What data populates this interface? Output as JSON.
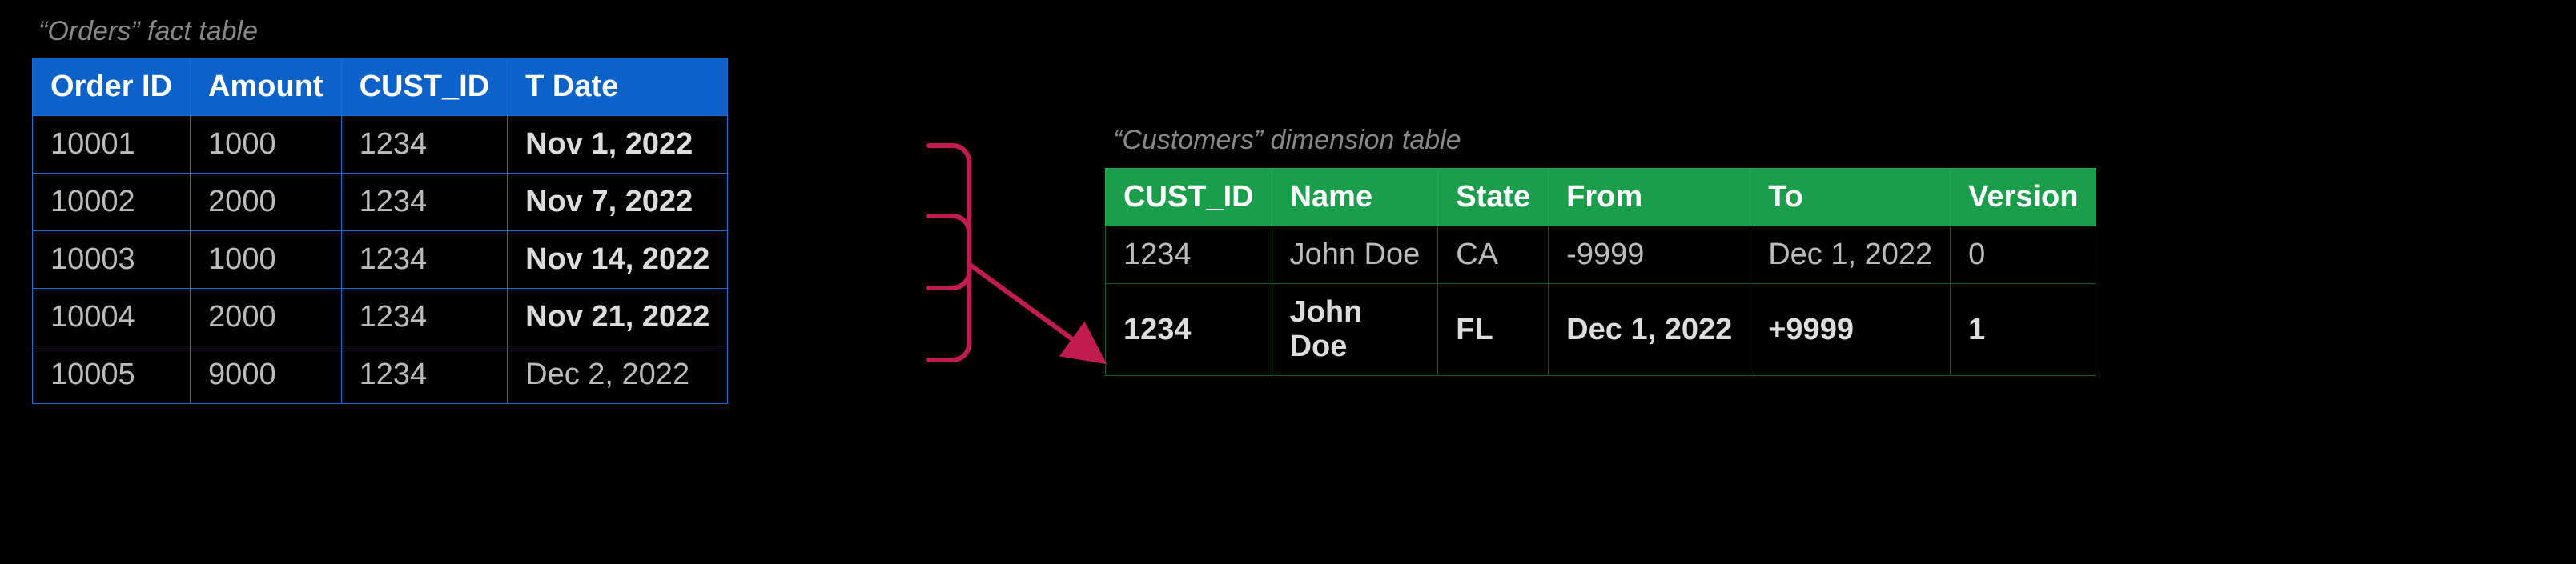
{
  "orders": {
    "caption": "“Orders” fact table",
    "headers": [
      "Order ID",
      "Amount",
      "CUST_ID",
      "T Date"
    ],
    "rows": [
      {
        "cells": [
          "10001",
          "1000",
          "1234",
          "Nov 1, 2022"
        ],
        "bold_cols": [
          3
        ]
      },
      {
        "cells": [
          "10002",
          "2000",
          "1234",
          "Nov 7, 2022"
        ],
        "bold_cols": [
          3
        ]
      },
      {
        "cells": [
          "10003",
          "1000",
          "1234",
          "Nov 14, 2022"
        ],
        "bold_cols": [
          3
        ]
      },
      {
        "cells": [
          "10004",
          "2000",
          "1234",
          "Nov 21, 2022"
        ],
        "bold_cols": [
          3
        ]
      },
      {
        "cells": [
          "10005",
          "9000",
          "1234",
          "Dec 2, 2022"
        ],
        "bold_cols": []
      }
    ]
  },
  "customers": {
    "caption": "“Customers” dimension table",
    "headers": [
      "CUST_ID",
      "Name",
      "State",
      "From",
      "To",
      "Version"
    ],
    "rows": [
      {
        "cells": [
          "1234",
          "John Doe",
          "CA",
          "-9999",
          "Dec 1, 2022",
          "0"
        ],
        "bold_row": false
      },
      {
        "cells": [
          "1234",
          "John Doe",
          "FL",
          "Dec 1, 2022",
          "+9999",
          "1"
        ],
        "bold_row": true,
        "wrap_cols": [
          1
        ]
      }
    ]
  },
  "relationship": {
    "type": "bracket-arrow",
    "from_table": "orders",
    "from_rows": [
      0,
      1,
      2,
      3
    ],
    "to_table": "customers",
    "to_row": 1
  },
  "colors": {
    "orders_header": "#0d62c9",
    "customers_header": "#1b9e4b",
    "arrow": "#c11c4f",
    "background": "#000000"
  }
}
